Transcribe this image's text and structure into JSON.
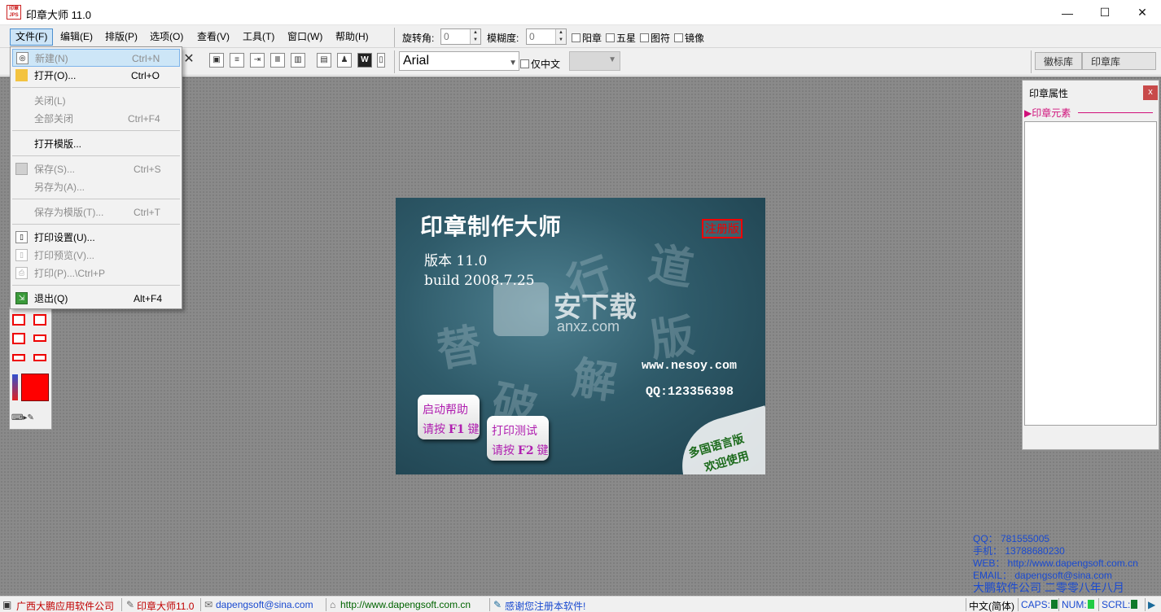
{
  "window": {
    "title": "印章大师 11.0",
    "icon_text": "印章\nJPS",
    "minimize": "—",
    "maximize": "☐",
    "close": "✕"
  },
  "menubar": {
    "items": [
      "文件(F)",
      "编辑(E)",
      "排版(P)",
      "选项(O)",
      "查看(V)",
      "工具(T)",
      "窗口(W)",
      "帮助(H)"
    ],
    "active_index": 0
  },
  "props_bar": {
    "rotation_label": "旋转角:",
    "rotation_value": "0",
    "blur_label": "模糊度:",
    "blur_value": "0",
    "checks": [
      "阳章",
      "五星",
      "图符",
      "镜像"
    ]
  },
  "font_bar": {
    "font_value": "Arial",
    "chinese_only_label": "仅中文",
    "size_value": ""
  },
  "library_tabs": [
    "徽标库",
    "印章库"
  ],
  "file_menu": {
    "items": [
      {
        "label": "新建(N)",
        "shortcut": "Ctrl+N",
        "enabled": false,
        "highlight": true,
        "icon": "new-doc-icon"
      },
      {
        "label": "打开(O)...",
        "shortcut": "Ctrl+O",
        "enabled": true,
        "icon": "open-folder-icon"
      },
      {
        "label": "关闭(L)",
        "shortcut": "",
        "enabled": false
      },
      {
        "label": "全部关闭",
        "shortcut": "Ctrl+F4",
        "enabled": false
      },
      {
        "label": "打开模版...",
        "shortcut": "",
        "enabled": true
      },
      {
        "label": "保存(S)...",
        "shortcut": "Ctrl+S",
        "enabled": false,
        "icon": "save-icon"
      },
      {
        "label": "另存为(A)...",
        "shortcut": "",
        "enabled": false
      },
      {
        "label": "保存为模版(T)...",
        "shortcut": "Ctrl+T",
        "enabled": false
      },
      {
        "label": "打印设置(U)...",
        "shortcut": "",
        "enabled": true,
        "icon": "print-setup-icon"
      },
      {
        "label": "打印预览(V)...",
        "shortcut": "",
        "enabled": false,
        "icon": "print-preview-icon"
      },
      {
        "label": "打印(P)...\\Ctrl+P",
        "shortcut": "",
        "enabled": false,
        "icon": "printer-icon"
      },
      {
        "label": "退出(Q)",
        "shortcut": "Alt+F4",
        "enabled": true,
        "icon": "exit-icon"
      }
    ]
  },
  "splash": {
    "title": "印章制作大师",
    "registered_badge": "注册版",
    "version_line": "版本 11.0",
    "build_line": "build 2008.7.25",
    "website": "www.nesoy.com",
    "qq": "QQ:123356398",
    "help_button": {
      "line1": "启动帮助",
      "line2_prefix": "请按",
      "key": "F1",
      "line2_suffix": "键"
    },
    "print_button": {
      "line1": "打印测试",
      "line2_prefix": "请按",
      "key": "F2",
      "line2_suffix": "键"
    },
    "corner_text_1": "多国语言版",
    "corner_text_2": "欢迎使用",
    "deco_chars": [
      "行",
      "道",
      "替",
      "破",
      "解",
      "版"
    ]
  },
  "watermark": {
    "text": "安下载",
    "url": "anxz.com"
  },
  "property_panel": {
    "title": "印章属性",
    "close": "x",
    "section": "印章元素"
  },
  "contact": {
    "qq": "QQ：  781555005",
    "phone": "手机：  13788680230",
    "web": "WEB：  http://www.dapengsoft.com.cn",
    "email": "EMAIL：  dapengsoft@sina.com",
    "company": "大鹏软件公司  二零零八年八月"
  },
  "statusbar": {
    "company": "广西大鹏应用软件公司",
    "product": "印章大师11.0",
    "email": "dapengsoft@sina.com",
    "website": "http://www.dapengsoft.com.cn",
    "thanks": "感谢您注册本软件!",
    "ime": "中文(简体)",
    "caps": "CAPS:",
    "num": "NUM:",
    "scrl": "SCRL:"
  },
  "colors": {
    "accent_menu": "#cce4f7",
    "status_blue": "#1a4ad0",
    "status_red": "#c00000",
    "current_color": "#ff0000"
  }
}
